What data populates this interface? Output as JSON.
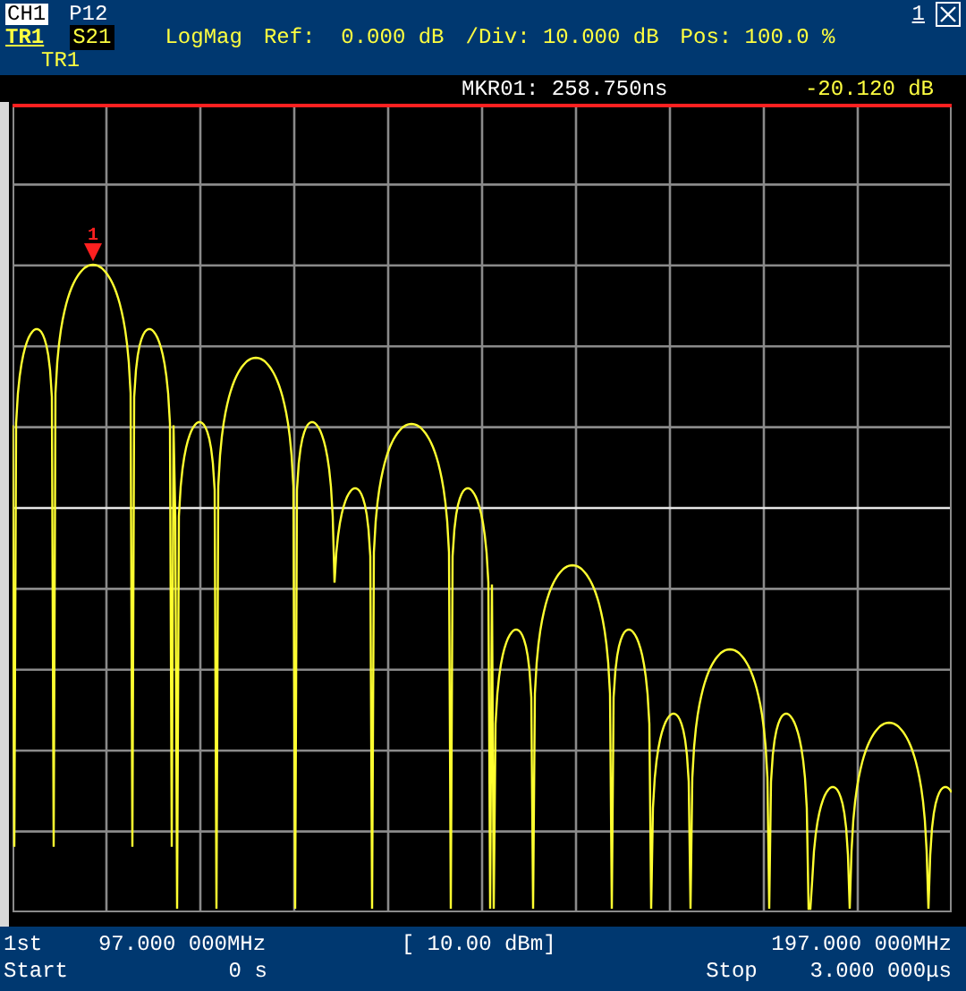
{
  "header": {
    "channel": "CH1",
    "parameter": "P12",
    "trace": "TR1",
    "measurement": "S21",
    "format": "LogMag",
    "ref": "Ref:  0.000 dB",
    "div": "/Div: 10.000 dB",
    "pos": "Pos: 100.0 %",
    "trace_label": "TR1",
    "window_number": "1"
  },
  "marker_readout": {
    "label": "MKR01: 258.750ns",
    "value": "-20.120 dB"
  },
  "plot": {
    "marker_label": "1"
  },
  "footer": {
    "rows": [
      {
        "left": "1st",
        "left_value": "97.000 000MHz",
        "center": "[ 10.00 dBm]",
        "right_label": "",
        "right_value": "197.000 000MHz"
      },
      {
        "left": "Start",
        "left_value": "0 s",
        "center": "",
        "right_label": "Stop",
        "right_value": "3.000 000μs"
      }
    ]
  }
}
